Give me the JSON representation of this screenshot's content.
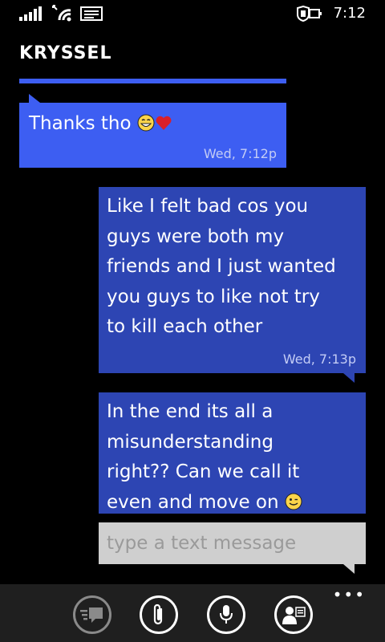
{
  "status_bar": {
    "time": "7:12",
    "icons": [
      "signal-icon",
      "wifi-icon",
      "message-icon",
      "battery-saver-icon"
    ]
  },
  "conversation": {
    "contact_name": "KRYSSEL",
    "messages": [
      {
        "direction": "incoming",
        "lines": [
          "Thanks tho"
        ],
        "emoji": [
          "smiling-emoji",
          "heart-emoji"
        ],
        "time": "Wed, 7:12p"
      },
      {
        "direction": "outgoing",
        "lines": [
          "Like I felt bad cos you",
          "guys were both my",
          "friends and I just wanted",
          "you guys to like not try",
          "to kill each other"
        ],
        "time": "Wed, 7:13p"
      },
      {
        "direction": "outgoing",
        "lines": [
          "In the end its all a",
          "misunderstanding",
          "right?? Can we call it",
          "even and move on"
        ],
        "emoji": [
          "winking-emoji"
        ]
      }
    ]
  },
  "compose": {
    "placeholder": "type a text message",
    "value": ""
  },
  "app_bar": {
    "more_label": "•••",
    "buttons": [
      "switch-conversation-icon",
      "attach-icon",
      "microphone-icon",
      "contact-card-icon"
    ]
  },
  "colors": {
    "incoming_bubble": "#3d5ef2",
    "outgoing_bubble": "#2d45b3",
    "compose_bg": "#cfcfcf",
    "app_bar_bg": "#1f1f1f"
  }
}
